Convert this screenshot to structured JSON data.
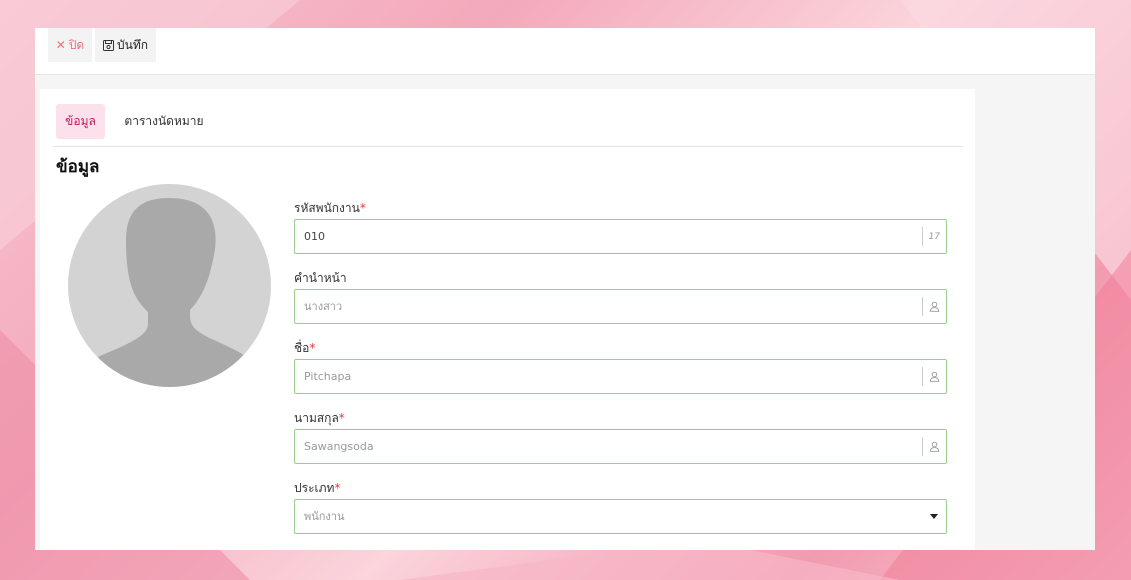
{
  "toolbar": {
    "close_label": "ปิด",
    "save_label": "บันทึก"
  },
  "tabs": [
    {
      "label": "ข้อมูล",
      "active": true
    },
    {
      "label": "ตารางนัดหมาย",
      "active": false
    }
  ],
  "section_title": "ข้อมูล",
  "fields": {
    "employee_code": {
      "label": "รหัสพนักงาน",
      "required": "*",
      "value": "010",
      "counter": "17"
    },
    "prefix": {
      "label": "คำนำหน้า",
      "required": "",
      "value": "นางสาว"
    },
    "first_name": {
      "label": "ชื่อ",
      "required": "*",
      "value": "Pitchapa"
    },
    "last_name": {
      "label": "นามสกุล",
      "required": "*",
      "value": "Sawangsoda"
    },
    "type": {
      "label": "ประเภท",
      "required": "*",
      "value": "พนักงาน"
    }
  },
  "icons": {
    "close": "close-icon",
    "save": "save-icon",
    "user": "user-icon",
    "dropdown": "caret-down-icon"
  },
  "colors": {
    "accent": "#c2185b",
    "tab_active_bg": "#fbe1ec",
    "close_text": "#f0707f",
    "input_border": "#9ccc8f",
    "required": "#e53935"
  }
}
